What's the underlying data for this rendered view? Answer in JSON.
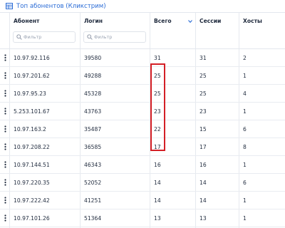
{
  "panel": {
    "title": "Топ абонентов (Кликстрим)",
    "icon": "table-icon"
  },
  "table": {
    "columns": [
      {
        "key": "subscriber",
        "label": "Абонент",
        "filter_placeholder": "Фильтр",
        "has_filter": true
      },
      {
        "key": "login",
        "label": "Логин",
        "filter_placeholder": "Фильтр",
        "has_filter": true
      },
      {
        "key": "total",
        "label": "Всего",
        "sort": "desc",
        "has_filter": false
      },
      {
        "key": "sessions",
        "label": "Сессии",
        "has_filter": false
      },
      {
        "key": "hosts",
        "label": "Хосты",
        "has_filter": false
      }
    ],
    "rows": [
      [
        "10.97.92.116",
        "39580",
        "31",
        "31",
        "2"
      ],
      [
        "10.97.201.62",
        "49288",
        "25",
        "25",
        "1"
      ],
      [
        "10.97.95.23",
        "45328",
        "25",
        "25",
        "4"
      ],
      [
        "5.253.101.67",
        "43763",
        "23",
        "23",
        "1"
      ],
      [
        "10.97.163.2",
        "35487",
        "22",
        "15",
        "6"
      ],
      [
        "10.97.208.22",
        "36585",
        "17",
        "17",
        "8"
      ],
      [
        "10.97.144.51",
        "46343",
        "16",
        "16",
        "1"
      ],
      [
        "10.97.220.35",
        "52052",
        "14",
        "14",
        "6"
      ],
      [
        "10.97.222.42",
        "41251",
        "14",
        "14",
        "1"
      ],
      [
        "10.97.101.26",
        "51364",
        "13",
        "13",
        "1"
      ]
    ]
  },
  "colors": {
    "accent": "#2b6cd6",
    "highlight": "#d41f26"
  }
}
